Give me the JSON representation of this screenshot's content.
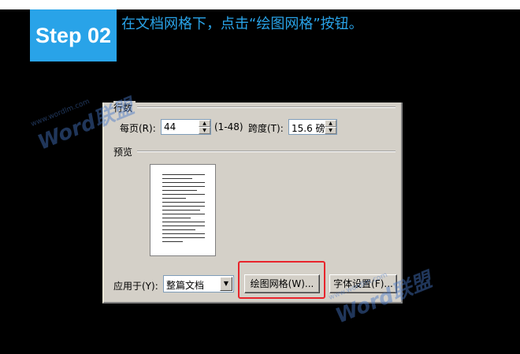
{
  "header": {
    "step_label": "Step 02",
    "instruction": "在文档网格下，点击“绘图网格”按钮。"
  },
  "dialog": {
    "lines_group": {
      "title": "行数",
      "per_page_label": "每页(R):",
      "per_page_value": "44",
      "per_page_range": "(1-48)",
      "pitch_label": "跨度(T):",
      "pitch_value": "15.6 磅"
    },
    "preview_group": {
      "title": "预览"
    },
    "apply_to": {
      "label": "应用于(Y):",
      "value": "整篇文档"
    },
    "buttons": {
      "drawing_grid": "绘图网格(W)...",
      "font_settings": "字体设置(F)..."
    }
  },
  "watermark": {
    "text": "Word联盟",
    "url": "www.wordlm.com"
  },
  "colors": {
    "accent": "#29a3e8",
    "highlight": "#e8242c",
    "dialog_bg": "#d4d0c8"
  }
}
